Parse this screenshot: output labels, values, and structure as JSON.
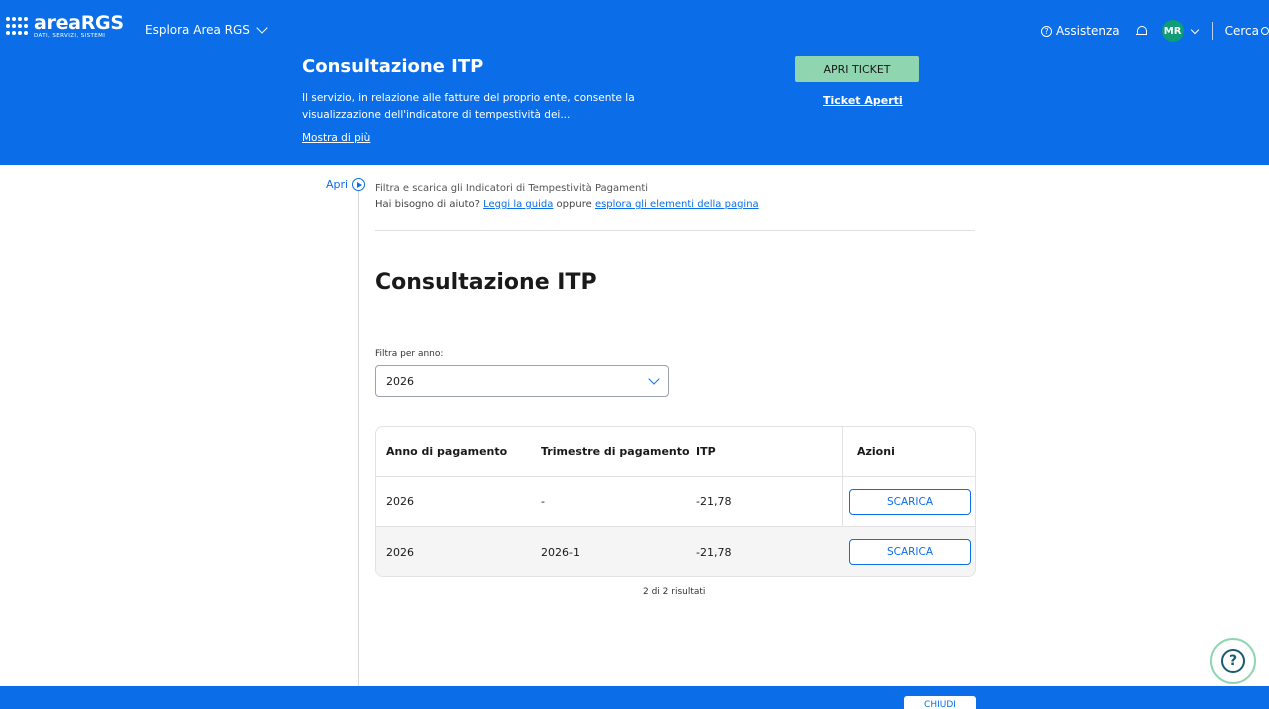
{
  "header": {
    "logo_main": "areaRGS",
    "logo_sub": "DATI, SERVIZI, SISTEMI",
    "explore_label": "Esplora Area RGS",
    "help_label": "Assistenza",
    "avatar_initials": "MR",
    "search_label": "Cerca"
  },
  "hero": {
    "title": "Consultazione ITP",
    "description": "Il servizio, in relazione alle fatture del proprio ente, consente la visualizzazione dell'indicatore di tempestività dei...",
    "more_link": "Mostra di più",
    "ticket_button": "APRI TICKET",
    "ticket_open_link": "Ticket Aperti"
  },
  "side": {
    "open_label": "Apri"
  },
  "intro": {
    "line1": "Filtra e scarica gli Indicatori di Tempestività Pagamenti",
    "help_prefix": "Hai bisogno di aiuto?",
    "guide_link": "Leggi la guida",
    "middle": "oppure",
    "explore_link": "esplora gli elementi della pagina"
  },
  "main": {
    "title": "Consultazione ITP",
    "filter_label": "Filtra per anno:",
    "filter_value": "2026"
  },
  "table": {
    "headers": [
      "Anno di pagamento",
      "Trimestre di pagamento",
      "ITP",
      "Azioni"
    ],
    "rows": [
      {
        "anno": "2026",
        "trimestre": "-",
        "itp": "-21,78",
        "action": "SCARICA"
      },
      {
        "anno": "2026",
        "trimestre": "2026-1",
        "itp": "-21,78",
        "action": "SCARICA"
      }
    ],
    "results": "2 di 2 risultati"
  },
  "fab": {
    "symbol": "?"
  },
  "footer": {
    "button_label": "CHIUDI"
  },
  "colors": {
    "primary": "#0b6ee8",
    "ticket": "#8fd6b0",
    "avatar": "#0f9d75"
  }
}
